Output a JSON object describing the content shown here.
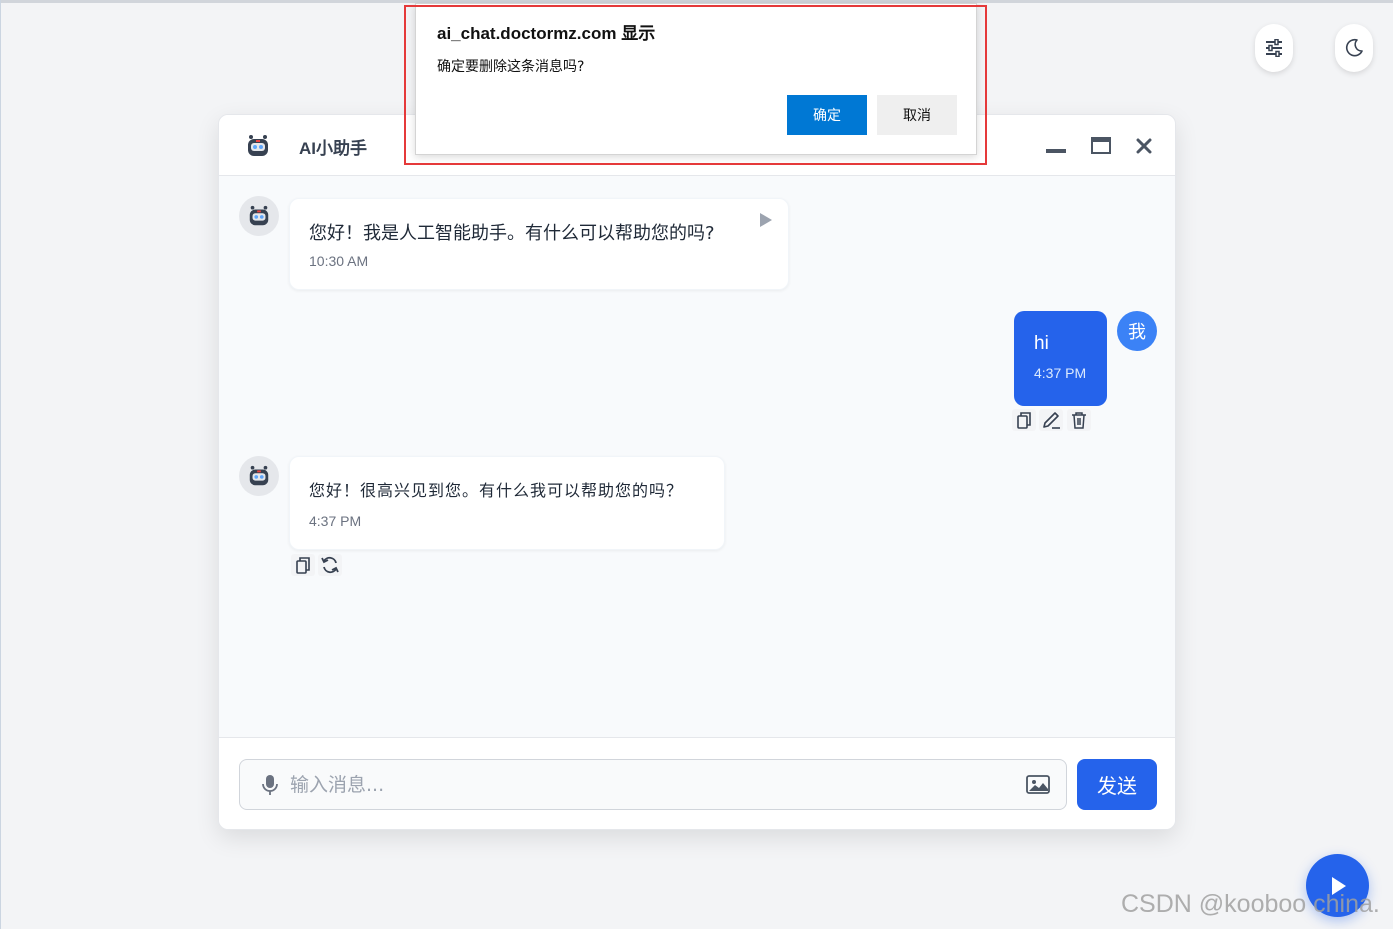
{
  "chat": {
    "title": "AI小助手",
    "messages": [
      {
        "role": "assistant",
        "text": "您好！我是人工智能助手。有什么可以帮助您的吗?",
        "time": "10:30 AM"
      },
      {
        "role": "user",
        "avatar_label": "我",
        "text": "hi",
        "time": "4:37 PM"
      },
      {
        "role": "assistant",
        "text": "您好！很高兴见到您。有什么我可以帮助您的吗？",
        "time": "4:37 PM"
      }
    ],
    "input": {
      "placeholder": "输入消息...",
      "value": ""
    },
    "send_label": "发送"
  },
  "alert": {
    "title": "ai_chat.doctormz.com 显示",
    "message": "确定要删除这条消息吗?",
    "ok_label": "确定",
    "cancel_label": "取消"
  },
  "watermark": "CSDN @kooboo china.",
  "colors": {
    "accent": "#2563eb",
    "dialog_ok": "#0078d4",
    "highlight_outline": "#e5393a",
    "background": "#f3f4f6"
  },
  "icons": [
    "settings-sliders-icon",
    "moon-icon",
    "robot-icon",
    "minimize-icon",
    "maximize-icon",
    "close-icon",
    "play-icon",
    "copy-icon",
    "edit-icon",
    "trash-icon",
    "regenerate-icon",
    "microphone-icon",
    "image-icon"
  ]
}
